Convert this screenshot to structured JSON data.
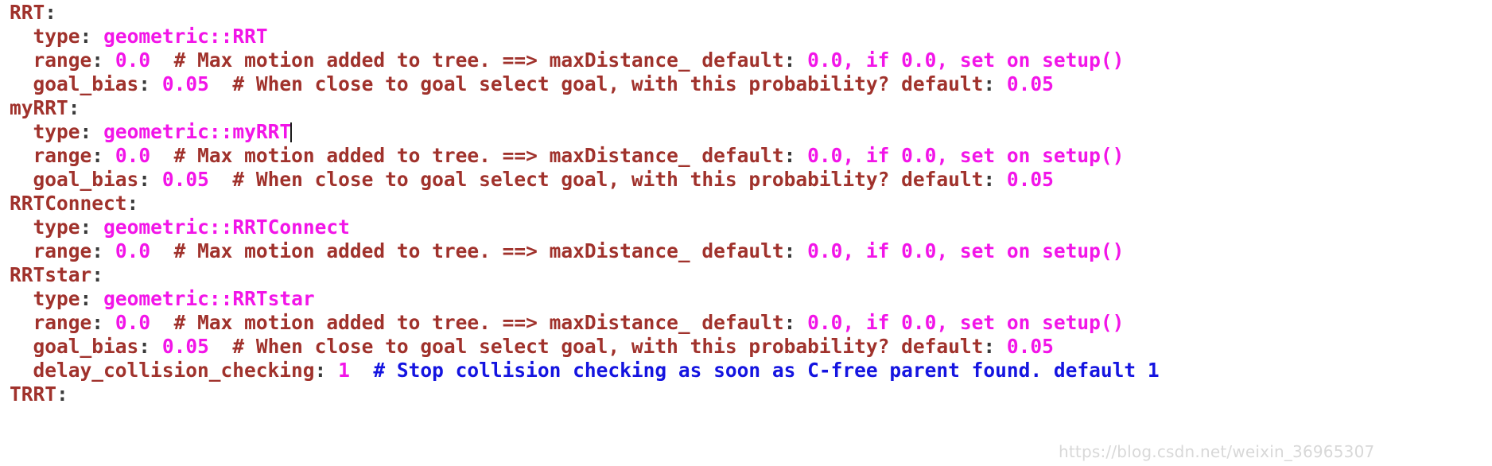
{
  "editor": {
    "app": "text-editor",
    "language": "yaml",
    "colors": {
      "background": "#ffffff",
      "key": "#A0322C",
      "punctuation": "#3A3A3A",
      "value": "#F215E8",
      "comment": "#A0322C",
      "comment_alt": "#1414E0",
      "caret": "#1a1a1a",
      "watermark": "#d8d8d8"
    },
    "caret": {
      "line": 6,
      "after_text": "geometric::myRRT"
    }
  },
  "lines": [
    {
      "id": "line-1",
      "indent": "",
      "tokens": [
        {
          "t": "key",
          "v": "RRT"
        },
        {
          "t": "punct",
          "v": ":"
        }
      ]
    },
    {
      "id": "line-2",
      "indent": "  ",
      "tokens": [
        {
          "t": "key",
          "v": "type"
        },
        {
          "t": "punct",
          "v": ":"
        },
        {
          "t": "plainspace",
          "v": " "
        },
        {
          "t": "val",
          "v": "geometric::RRT"
        }
      ]
    },
    {
      "id": "line-3",
      "indent": "  ",
      "tokens": [
        {
          "t": "key",
          "v": "range"
        },
        {
          "t": "punct",
          "v": ":"
        },
        {
          "t": "plainspace",
          "v": " "
        },
        {
          "t": "val",
          "v": "0.0"
        },
        {
          "t": "comment",
          "v": "  # Max motion added to tree. ==> maxDistance_ default"
        },
        {
          "t": "punct",
          "v": ":"
        },
        {
          "t": "val",
          "v": " 0.0, if 0.0, set on setup()"
        }
      ]
    },
    {
      "id": "line-4",
      "indent": "  ",
      "tokens": [
        {
          "t": "key",
          "v": "goal_bias"
        },
        {
          "t": "punct",
          "v": ":"
        },
        {
          "t": "plainspace",
          "v": " "
        },
        {
          "t": "val",
          "v": "0.05"
        },
        {
          "t": "comment",
          "v": "  # When close to goal select goal, with this probability? default"
        },
        {
          "t": "punct",
          "v": ":"
        },
        {
          "t": "val",
          "v": " 0.05"
        }
      ]
    },
    {
      "id": "line-5",
      "indent": "",
      "tokens": [
        {
          "t": "key",
          "v": "myRRT"
        },
        {
          "t": "punct",
          "v": ":"
        }
      ]
    },
    {
      "id": "line-6",
      "indent": "  ",
      "tokens": [
        {
          "t": "key",
          "v": "type"
        },
        {
          "t": "punct",
          "v": ":"
        },
        {
          "t": "plainspace",
          "v": " "
        },
        {
          "t": "val",
          "v": "geometric::myRRT"
        },
        {
          "t": "caret",
          "v": ""
        }
      ]
    },
    {
      "id": "line-7",
      "indent": "  ",
      "tokens": [
        {
          "t": "key",
          "v": "range"
        },
        {
          "t": "punct",
          "v": ":"
        },
        {
          "t": "plainspace",
          "v": " "
        },
        {
          "t": "val",
          "v": "0.0"
        },
        {
          "t": "comment",
          "v": "  # Max motion added to tree. ==> maxDistance_ default"
        },
        {
          "t": "punct",
          "v": ":"
        },
        {
          "t": "val",
          "v": " 0.0, if 0.0, set on setup()"
        }
      ]
    },
    {
      "id": "line-8",
      "indent": "  ",
      "tokens": [
        {
          "t": "key",
          "v": "goal_bias"
        },
        {
          "t": "punct",
          "v": ":"
        },
        {
          "t": "plainspace",
          "v": " "
        },
        {
          "t": "val",
          "v": "0.05"
        },
        {
          "t": "comment",
          "v": "  # When close to goal select goal, with this probability? default"
        },
        {
          "t": "punct",
          "v": ":"
        },
        {
          "t": "val",
          "v": " 0.05"
        }
      ]
    },
    {
      "id": "line-9",
      "indent": "",
      "tokens": [
        {
          "t": "key",
          "v": "RRTConnect"
        },
        {
          "t": "punct",
          "v": ":"
        }
      ]
    },
    {
      "id": "line-10",
      "indent": "  ",
      "tokens": [
        {
          "t": "key",
          "v": "type"
        },
        {
          "t": "punct",
          "v": ":"
        },
        {
          "t": "plainspace",
          "v": " "
        },
        {
          "t": "val",
          "v": "geometric::RRTConnect"
        }
      ]
    },
    {
      "id": "line-11",
      "indent": "  ",
      "tokens": [
        {
          "t": "key",
          "v": "range"
        },
        {
          "t": "punct",
          "v": ":"
        },
        {
          "t": "plainspace",
          "v": " "
        },
        {
          "t": "val",
          "v": "0.0"
        },
        {
          "t": "comment",
          "v": "  # Max motion added to tree. ==> maxDistance_ default"
        },
        {
          "t": "punct",
          "v": ":"
        },
        {
          "t": "val",
          "v": " 0.0, if 0.0, set on setup()"
        }
      ]
    },
    {
      "id": "line-12",
      "indent": "",
      "tokens": [
        {
          "t": "key",
          "v": "RRTstar"
        },
        {
          "t": "punct",
          "v": ":"
        }
      ]
    },
    {
      "id": "line-13",
      "indent": "  ",
      "tokens": [
        {
          "t": "key",
          "v": "type"
        },
        {
          "t": "punct",
          "v": ":"
        },
        {
          "t": "plainspace",
          "v": " "
        },
        {
          "t": "val",
          "v": "geometric::RRTstar"
        }
      ]
    },
    {
      "id": "line-14",
      "indent": "  ",
      "tokens": [
        {
          "t": "key",
          "v": "range"
        },
        {
          "t": "punct",
          "v": ":"
        },
        {
          "t": "plainspace",
          "v": " "
        },
        {
          "t": "val",
          "v": "0.0"
        },
        {
          "t": "comment",
          "v": "  # Max motion added to tree. ==> maxDistance_ default"
        },
        {
          "t": "punct",
          "v": ":"
        },
        {
          "t": "val",
          "v": " 0.0, if 0.0, set on setup()"
        }
      ]
    },
    {
      "id": "line-15",
      "indent": "  ",
      "tokens": [
        {
          "t": "key",
          "v": "goal_bias"
        },
        {
          "t": "punct",
          "v": ":"
        },
        {
          "t": "plainspace",
          "v": " "
        },
        {
          "t": "val",
          "v": "0.05"
        },
        {
          "t": "comment",
          "v": "  # When close to goal select goal, with this probability? default"
        },
        {
          "t": "punct",
          "v": ":"
        },
        {
          "t": "val",
          "v": " 0.05"
        }
      ]
    },
    {
      "id": "line-16",
      "indent": "  ",
      "tokens": [
        {
          "t": "key",
          "v": "delay_collision_checking"
        },
        {
          "t": "punct",
          "v": ":"
        },
        {
          "t": "plainspace",
          "v": " "
        },
        {
          "t": "val",
          "v": "1"
        },
        {
          "t": "comment-blue",
          "v": "  # Stop collision checking as soon as C-free parent found. default 1"
        }
      ]
    },
    {
      "id": "line-17",
      "indent": "",
      "tokens": [
        {
          "t": "key",
          "v": "TRRT"
        },
        {
          "t": "punct",
          "v": ":"
        }
      ]
    }
  ],
  "watermark": {
    "text": "https://blog.csdn.net/weixin_36965307"
  }
}
